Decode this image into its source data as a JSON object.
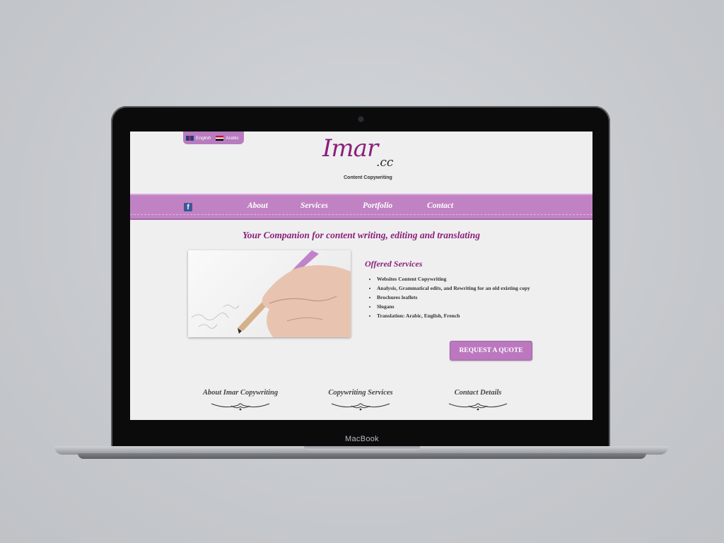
{
  "device": {
    "label": "MacBook"
  },
  "site": {
    "languages": [
      {
        "label": "English",
        "flag": "uk-flag-icon"
      },
      {
        "label": "Arabic",
        "flag": "egypt-flag-icon"
      }
    ],
    "logo": {
      "main": "Imar",
      "tld": ".cc",
      "tagline": "Content Copywriting"
    },
    "nav": {
      "social": "f",
      "items": [
        "About",
        "Services",
        "Portfolio",
        "Contact"
      ]
    },
    "headline": "Your Companion for content writing, editing and translating",
    "offered": {
      "title": "Offered Services",
      "items": [
        "Websites Content Copywriting",
        "Analysis, Grammatical edits, and Rewriting for an old existing copy",
        "Brochures leaflets",
        "Slogans",
        "Translation: Arabic, English, French"
      ]
    },
    "cta": {
      "label": "REQUEST A QUOTE"
    },
    "footer": {
      "columns": [
        "About Imar Copywriting",
        "Copywriting Services",
        "Contact Details"
      ]
    },
    "colors": {
      "accent": "#8b1f7a",
      "nav": "#c182c4",
      "button": "#bb78bf"
    }
  }
}
